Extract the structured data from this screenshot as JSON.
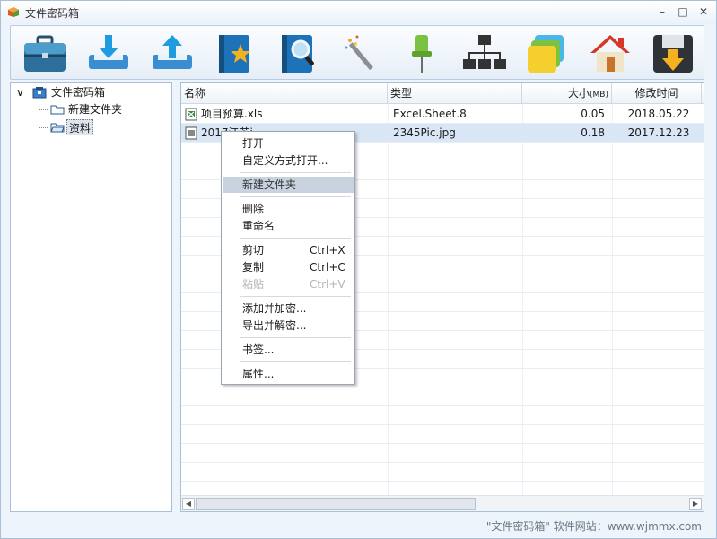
{
  "window": {
    "title": "文件密码箱",
    "minimize": "–",
    "maximize": "□",
    "close": "✕"
  },
  "toolbar": {
    "buttons": [
      {
        "icon": "briefcase-icon"
      },
      {
        "icon": "download-icon"
      },
      {
        "icon": "upload-icon"
      },
      {
        "icon": "bookmark-notebook-icon"
      },
      {
        "icon": "search-notebook-icon"
      },
      {
        "icon": "magic-wand-icon"
      },
      {
        "icon": "pin-icon"
      },
      {
        "icon": "network-icon"
      },
      {
        "icon": "cards-icon"
      },
      {
        "icon": "home-icon"
      },
      {
        "icon": "save-icon"
      }
    ]
  },
  "tree": {
    "toggle": "∨",
    "root": "文件密码箱",
    "children": [
      "新建文件夹",
      "资料"
    ]
  },
  "table": {
    "headers": {
      "name": "名称",
      "type": "类型",
      "size": "大小",
      "size_unit": "(MB)",
      "modified": "修改时间"
    },
    "rows": [
      {
        "name": "项目预算.xls",
        "type": "Excel.Sheet.8",
        "size": "0.05",
        "modified": "2018.05.22"
      },
      {
        "name": "2017江苏i...",
        "type": "2345Pic.jpg",
        "size": "0.18",
        "modified": "2017.12.23"
      }
    ]
  },
  "context_menu": {
    "open": "打开",
    "open_with": "自定义方式打开...",
    "new_folder": "新建文件夹",
    "delete": "删除",
    "rename": "重命名",
    "cut": "剪切",
    "cut_key": "Ctrl+X",
    "copy": "复制",
    "copy_key": "Ctrl+C",
    "paste": "粘贴",
    "paste_key": "Ctrl+V",
    "add_encrypt": "添加并加密...",
    "export_decrypt": "导出并解密...",
    "bookmark": "书签...",
    "properties": "属性..."
  },
  "scroll": {
    "left": "◀",
    "right": "▶"
  },
  "footer": {
    "text": "\"文件密码箱\" 软件网站：www.wjmmx.com"
  }
}
